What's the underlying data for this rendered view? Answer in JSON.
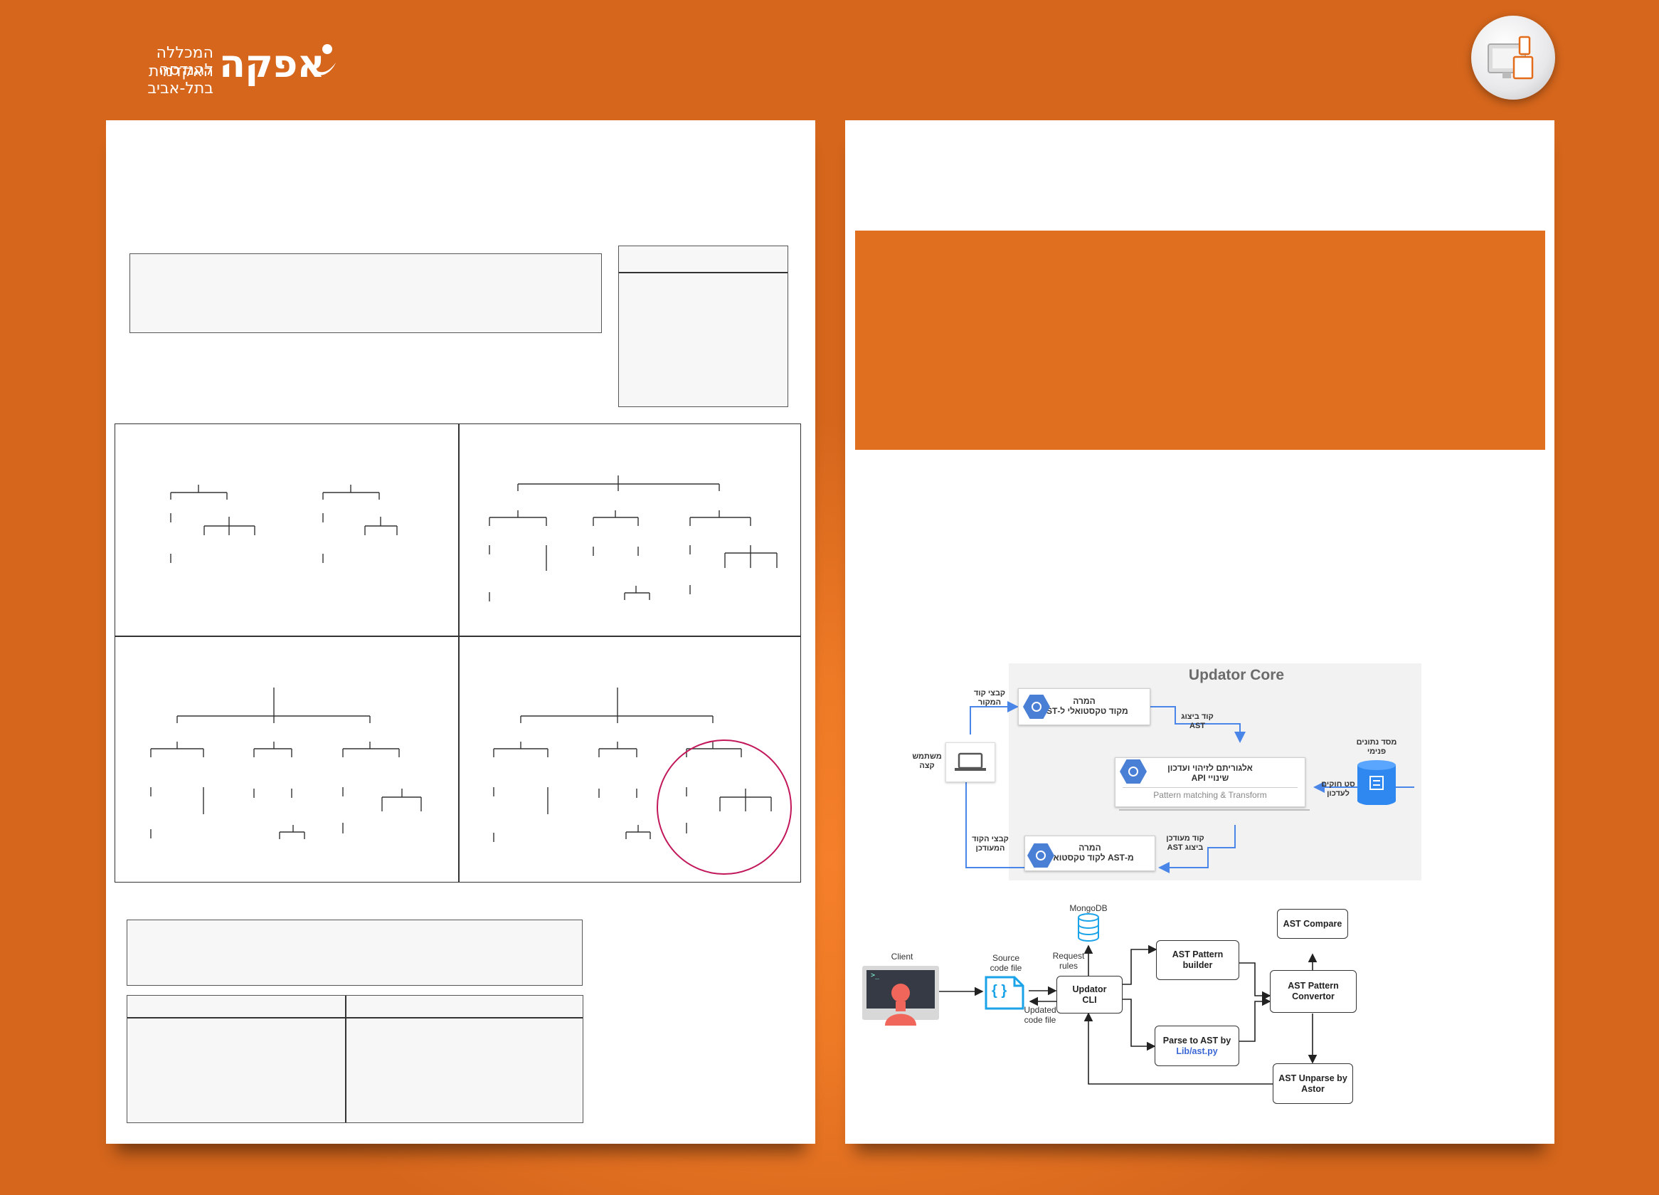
{
  "logo": {
    "wordmark": "אפקה",
    "subtitle_line1": "המכללה האקדמית",
    "subtitle_line2": "להנדסה בתל-אביב",
    "icon": "afeka-swoosh-icon",
    "colors": {
      "text": "#ffffff",
      "background_orange": "#e9721f"
    }
  },
  "badge": {
    "icon": "devices-monitor-icon"
  },
  "core_diagram": {
    "title": "Updator Core",
    "to_ast_box": {
      "line1": "המרה",
      "line2": "מקוד טקסטואלי ל-AST"
    },
    "algo_box": {
      "line1": "אלגוריתם לזיהוי ועדכון",
      "line2": "שינויי API",
      "subtitle": "Pattern matching & Transform"
    },
    "from_ast_box": {
      "line1": "המרה",
      "line2": "מ-AST לקוד טקסטואלי"
    },
    "label_source_files": {
      "line1": "קבצי קוד",
      "line2": "המקור"
    },
    "label_ast_code": {
      "line1": "קוד ביצוג",
      "line2": "AST"
    },
    "label_end_user": {
      "line1": "משתמש",
      "line2": "קצה"
    },
    "label_internal_db": {
      "line1": "מסד נתונים",
      "line2": "פנימי"
    },
    "label_update_rules": {
      "line1": "סט חוקים",
      "line2": "לעדכון"
    },
    "label_updated_ast": {
      "line1": "קוד מעודכן",
      "line2": "ביצוג AST"
    },
    "label_updated_files": {
      "line1": "קבצי הקוד",
      "line2": "המעודכן"
    },
    "accent": "#4a86e8"
  },
  "arch_diagram": {
    "client": "Client",
    "mongodb": "MongoDB",
    "source_code_file": {
      "line1": "Source",
      "line2": "code file"
    },
    "request_rules": {
      "line1": "Request",
      "line2": "rules"
    },
    "updated_code_file": {
      "line1": "Updated",
      "line2": "code file"
    },
    "updator_cli": {
      "line1": "Updator",
      "line2": "CLI"
    },
    "ast_pattern_builder": {
      "line1": "AST Pattern",
      "line2": "builder"
    },
    "parse_to_ast": {
      "line1": "Parse to AST by",
      "line2": "Lib/ast.py"
    },
    "ast_compare": "AST Compare",
    "ast_pattern_convertor": {
      "line1": "AST Pattern",
      "line2": "Convertor"
    },
    "ast_unparse": {
      "line1": "AST Unparse by",
      "line2": "Astor"
    },
    "source_icon_text": "{ }",
    "colors": {
      "link": "#3a66d6",
      "source_icon": "#1aa3e8",
      "client_figure": "#f0665a"
    }
  },
  "colors": {
    "orange_block": "#e0701f",
    "tree_highlight_circle": "#c2185b"
  }
}
